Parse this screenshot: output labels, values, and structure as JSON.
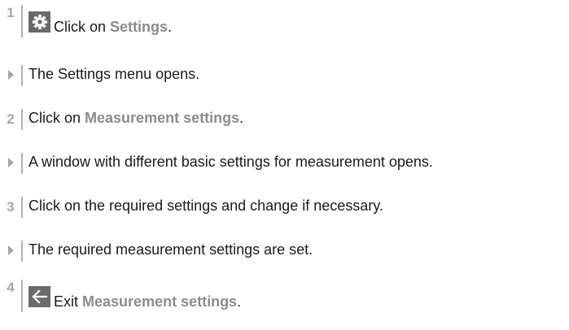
{
  "steps": [
    {
      "kind": "number",
      "marker": "1",
      "icon": "gear-icon",
      "text_before": "Click on ",
      "highlight": "Settings",
      "text_after": "."
    },
    {
      "kind": "result",
      "text": "The Settings menu opens."
    },
    {
      "kind": "number",
      "marker": "2",
      "text_before": "Click on ",
      "highlight": "Measurement settings",
      "text_after": "."
    },
    {
      "kind": "result",
      "text": "A window with different basic settings for measurement opens."
    },
    {
      "kind": "number",
      "marker": "3",
      "text": "Click on the required settings and change if necessary."
    },
    {
      "kind": "result",
      "text": "The required measurement settings are set."
    },
    {
      "kind": "number",
      "marker": "4",
      "icon": "back-arrow-icon",
      "text_before": "Exit ",
      "highlight": "Measurement settings",
      "text_after": "."
    }
  ],
  "colors": {
    "marker": "#a6a6a6",
    "highlight": "#8c8c8c",
    "icon_bg": "#6b6b6b",
    "rule": "#b3b3b3"
  }
}
